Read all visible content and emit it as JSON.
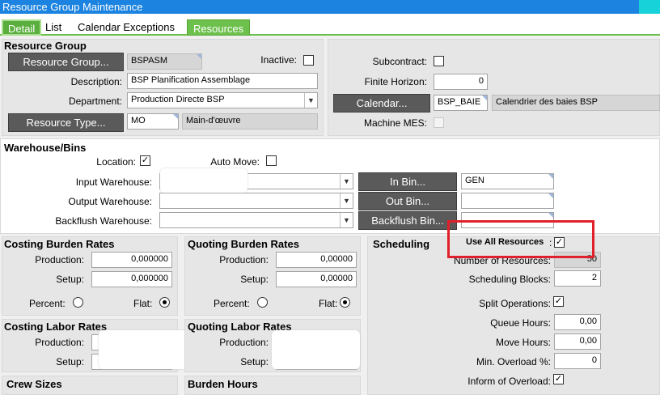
{
  "window": {
    "title": "Resource Group Maintenance"
  },
  "tabs": {
    "detail": "Detail",
    "list": "List",
    "calendar_exceptions": "Calendar Exceptions",
    "resources": "Resources"
  },
  "resource_group": {
    "section_title": "Resource Group",
    "resource_group_button": "Resource Group...",
    "resource_group_value": "BSPASM",
    "inactive_label": "Inactive:",
    "description_label": "Description:",
    "description_value": "BSP Planification Assemblage",
    "department_label": "Department:",
    "department_value": "Production Directe BSP",
    "resource_type_button": "Resource Type...",
    "resource_type_value": "MO",
    "resource_type_desc": "Main-d'œuvre",
    "subcontract_label": "Subcontract:",
    "finite_horizon_label": "Finite Horizon:",
    "finite_horizon_value": "0",
    "calendar_button": "Calendar...",
    "calendar_value": "BSP_BAIE",
    "calendar_desc": "Calendrier des baies BSP",
    "machine_mes_label": "Machine MES:"
  },
  "warehouse": {
    "section_title": "Warehouse/Bins",
    "location_label": "Location:",
    "auto_move_label": "Auto Move:",
    "input_warehouse_label": "Input Warehouse:",
    "output_warehouse_label": "Output Warehouse:",
    "backflush_warehouse_label": "Backflush Warehouse:",
    "in_bin_button": "In Bin...",
    "in_bin_value": "GEN",
    "out_bin_button": "Out Bin...",
    "backflush_bin_button": "Backflush Bin..."
  },
  "costing_burden": {
    "title": "Costing Burden Rates",
    "production_label": "Production:",
    "production_value": "0,000000",
    "setup_label": "Setup:",
    "setup_value": "0,000000",
    "percent_label": "Percent:",
    "flat_label": "Flat:"
  },
  "quoting_burden": {
    "title": "Quoting Burden Rates",
    "production_label": "Production:",
    "production_value": "0,00000",
    "setup_label": "Setup:",
    "setup_value": "0,00000",
    "percent_label": "Percent:",
    "flat_label": "Flat:"
  },
  "costing_labor": {
    "title": "Costing Labor Rates",
    "production_label": "Production:",
    "setup_label": "Setup:"
  },
  "quoting_labor": {
    "title": "Quoting Labor Rates",
    "production_label": "Production:",
    "setup_label": "Setup:"
  },
  "crew_sizes": {
    "title": "Crew Sizes"
  },
  "burden_hours": {
    "title": "Burden Hours"
  },
  "scheduling": {
    "title": "Scheduling",
    "use_all_resources_label": "Use All Resources",
    "use_all_resources_colon": ":",
    "number_of_resources_label": "Number of Resources:",
    "number_of_resources_value": "50",
    "scheduling_blocks_label": "Scheduling Blocks:",
    "scheduling_blocks_value": "2",
    "split_operations_label": "Split Operations:",
    "queue_hours_label": "Queue Hours:",
    "queue_hours_value": "0,00",
    "move_hours_label": "Move Hours:",
    "move_hours_value": "0,00",
    "min_overload_label": "Min. Overload %:",
    "min_overload_value": "0",
    "inform_overload_label": "Inform of Overload:"
  },
  "states": {
    "inactive": false,
    "subcontract": false,
    "machine_mes": false,
    "location": true,
    "auto_move": false,
    "use_all_resources": true,
    "split_operations": true,
    "inform_of_overload": true,
    "costing_burden_mode": "flat",
    "quoting_burden_mode": "flat"
  },
  "colors": {
    "titlebar": "#1c84e0",
    "tab_green": "#59ae3d",
    "highlight_box": "#e0202a",
    "button_dark": "#5a5a5a"
  },
  "check_glyph": "✓"
}
